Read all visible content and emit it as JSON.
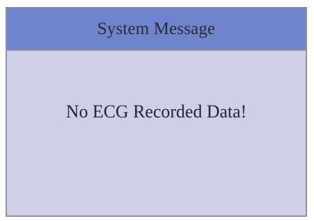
{
  "dialog": {
    "title": "System Message",
    "message": "No ECG Recorded Data!"
  },
  "colors": {
    "title_bar": "#6f84cc",
    "dialog_background": "#cfd0e8",
    "text": "#262630"
  }
}
